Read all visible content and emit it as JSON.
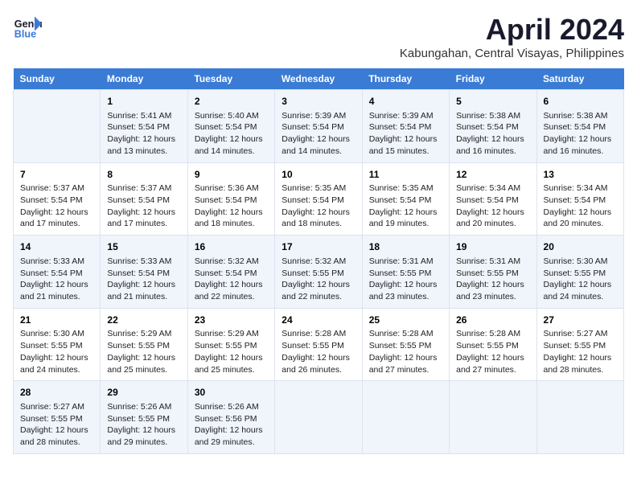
{
  "header": {
    "logo_line1": "General",
    "logo_line2": "Blue",
    "title": "April 2024",
    "subtitle": "Kabungahan, Central Visayas, Philippines"
  },
  "columns": [
    "Sunday",
    "Monday",
    "Tuesday",
    "Wednesday",
    "Thursday",
    "Friday",
    "Saturday"
  ],
  "weeks": [
    [
      {
        "day": "",
        "lines": []
      },
      {
        "day": "1",
        "lines": [
          "Sunrise: 5:41 AM",
          "Sunset: 5:54 PM",
          "Daylight: 12 hours",
          "and 13 minutes."
        ]
      },
      {
        "day": "2",
        "lines": [
          "Sunrise: 5:40 AM",
          "Sunset: 5:54 PM",
          "Daylight: 12 hours",
          "and 14 minutes."
        ]
      },
      {
        "day": "3",
        "lines": [
          "Sunrise: 5:39 AM",
          "Sunset: 5:54 PM",
          "Daylight: 12 hours",
          "and 14 minutes."
        ]
      },
      {
        "day": "4",
        "lines": [
          "Sunrise: 5:39 AM",
          "Sunset: 5:54 PM",
          "Daylight: 12 hours",
          "and 15 minutes."
        ]
      },
      {
        "day": "5",
        "lines": [
          "Sunrise: 5:38 AM",
          "Sunset: 5:54 PM",
          "Daylight: 12 hours",
          "and 16 minutes."
        ]
      },
      {
        "day": "6",
        "lines": [
          "Sunrise: 5:38 AM",
          "Sunset: 5:54 PM",
          "Daylight: 12 hours",
          "and 16 minutes."
        ]
      }
    ],
    [
      {
        "day": "7",
        "lines": [
          "Sunrise: 5:37 AM",
          "Sunset: 5:54 PM",
          "Daylight: 12 hours",
          "and 17 minutes."
        ]
      },
      {
        "day": "8",
        "lines": [
          "Sunrise: 5:37 AM",
          "Sunset: 5:54 PM",
          "Daylight: 12 hours",
          "and 17 minutes."
        ]
      },
      {
        "day": "9",
        "lines": [
          "Sunrise: 5:36 AM",
          "Sunset: 5:54 PM",
          "Daylight: 12 hours",
          "and 18 minutes."
        ]
      },
      {
        "day": "10",
        "lines": [
          "Sunrise: 5:35 AM",
          "Sunset: 5:54 PM",
          "Daylight: 12 hours",
          "and 18 minutes."
        ]
      },
      {
        "day": "11",
        "lines": [
          "Sunrise: 5:35 AM",
          "Sunset: 5:54 PM",
          "Daylight: 12 hours",
          "and 19 minutes."
        ]
      },
      {
        "day": "12",
        "lines": [
          "Sunrise: 5:34 AM",
          "Sunset: 5:54 PM",
          "Daylight: 12 hours",
          "and 20 minutes."
        ]
      },
      {
        "day": "13",
        "lines": [
          "Sunrise: 5:34 AM",
          "Sunset: 5:54 PM",
          "Daylight: 12 hours",
          "and 20 minutes."
        ]
      }
    ],
    [
      {
        "day": "14",
        "lines": [
          "Sunrise: 5:33 AM",
          "Sunset: 5:54 PM",
          "Daylight: 12 hours",
          "and 21 minutes."
        ]
      },
      {
        "day": "15",
        "lines": [
          "Sunrise: 5:33 AM",
          "Sunset: 5:54 PM",
          "Daylight: 12 hours",
          "and 21 minutes."
        ]
      },
      {
        "day": "16",
        "lines": [
          "Sunrise: 5:32 AM",
          "Sunset: 5:54 PM",
          "Daylight: 12 hours",
          "and 22 minutes."
        ]
      },
      {
        "day": "17",
        "lines": [
          "Sunrise: 5:32 AM",
          "Sunset: 5:55 PM",
          "Daylight: 12 hours",
          "and 22 minutes."
        ]
      },
      {
        "day": "18",
        "lines": [
          "Sunrise: 5:31 AM",
          "Sunset: 5:55 PM",
          "Daylight: 12 hours",
          "and 23 minutes."
        ]
      },
      {
        "day": "19",
        "lines": [
          "Sunrise: 5:31 AM",
          "Sunset: 5:55 PM",
          "Daylight: 12 hours",
          "and 23 minutes."
        ]
      },
      {
        "day": "20",
        "lines": [
          "Sunrise: 5:30 AM",
          "Sunset: 5:55 PM",
          "Daylight: 12 hours",
          "and 24 minutes."
        ]
      }
    ],
    [
      {
        "day": "21",
        "lines": [
          "Sunrise: 5:30 AM",
          "Sunset: 5:55 PM",
          "Daylight: 12 hours",
          "and 24 minutes."
        ]
      },
      {
        "day": "22",
        "lines": [
          "Sunrise: 5:29 AM",
          "Sunset: 5:55 PM",
          "Daylight: 12 hours",
          "and 25 minutes."
        ]
      },
      {
        "day": "23",
        "lines": [
          "Sunrise: 5:29 AM",
          "Sunset: 5:55 PM",
          "Daylight: 12 hours",
          "and 25 minutes."
        ]
      },
      {
        "day": "24",
        "lines": [
          "Sunrise: 5:28 AM",
          "Sunset: 5:55 PM",
          "Daylight: 12 hours",
          "and 26 minutes."
        ]
      },
      {
        "day": "25",
        "lines": [
          "Sunrise: 5:28 AM",
          "Sunset: 5:55 PM",
          "Daylight: 12 hours",
          "and 27 minutes."
        ]
      },
      {
        "day": "26",
        "lines": [
          "Sunrise: 5:28 AM",
          "Sunset: 5:55 PM",
          "Daylight: 12 hours",
          "and 27 minutes."
        ]
      },
      {
        "day": "27",
        "lines": [
          "Sunrise: 5:27 AM",
          "Sunset: 5:55 PM",
          "Daylight: 12 hours",
          "and 28 minutes."
        ]
      }
    ],
    [
      {
        "day": "28",
        "lines": [
          "Sunrise: 5:27 AM",
          "Sunset: 5:55 PM",
          "Daylight: 12 hours",
          "and 28 minutes."
        ]
      },
      {
        "day": "29",
        "lines": [
          "Sunrise: 5:26 AM",
          "Sunset: 5:55 PM",
          "Daylight: 12 hours",
          "and 29 minutes."
        ]
      },
      {
        "day": "30",
        "lines": [
          "Sunrise: 5:26 AM",
          "Sunset: 5:56 PM",
          "Daylight: 12 hours",
          "and 29 minutes."
        ]
      },
      {
        "day": "",
        "lines": []
      },
      {
        "day": "",
        "lines": []
      },
      {
        "day": "",
        "lines": []
      },
      {
        "day": "",
        "lines": []
      }
    ]
  ]
}
